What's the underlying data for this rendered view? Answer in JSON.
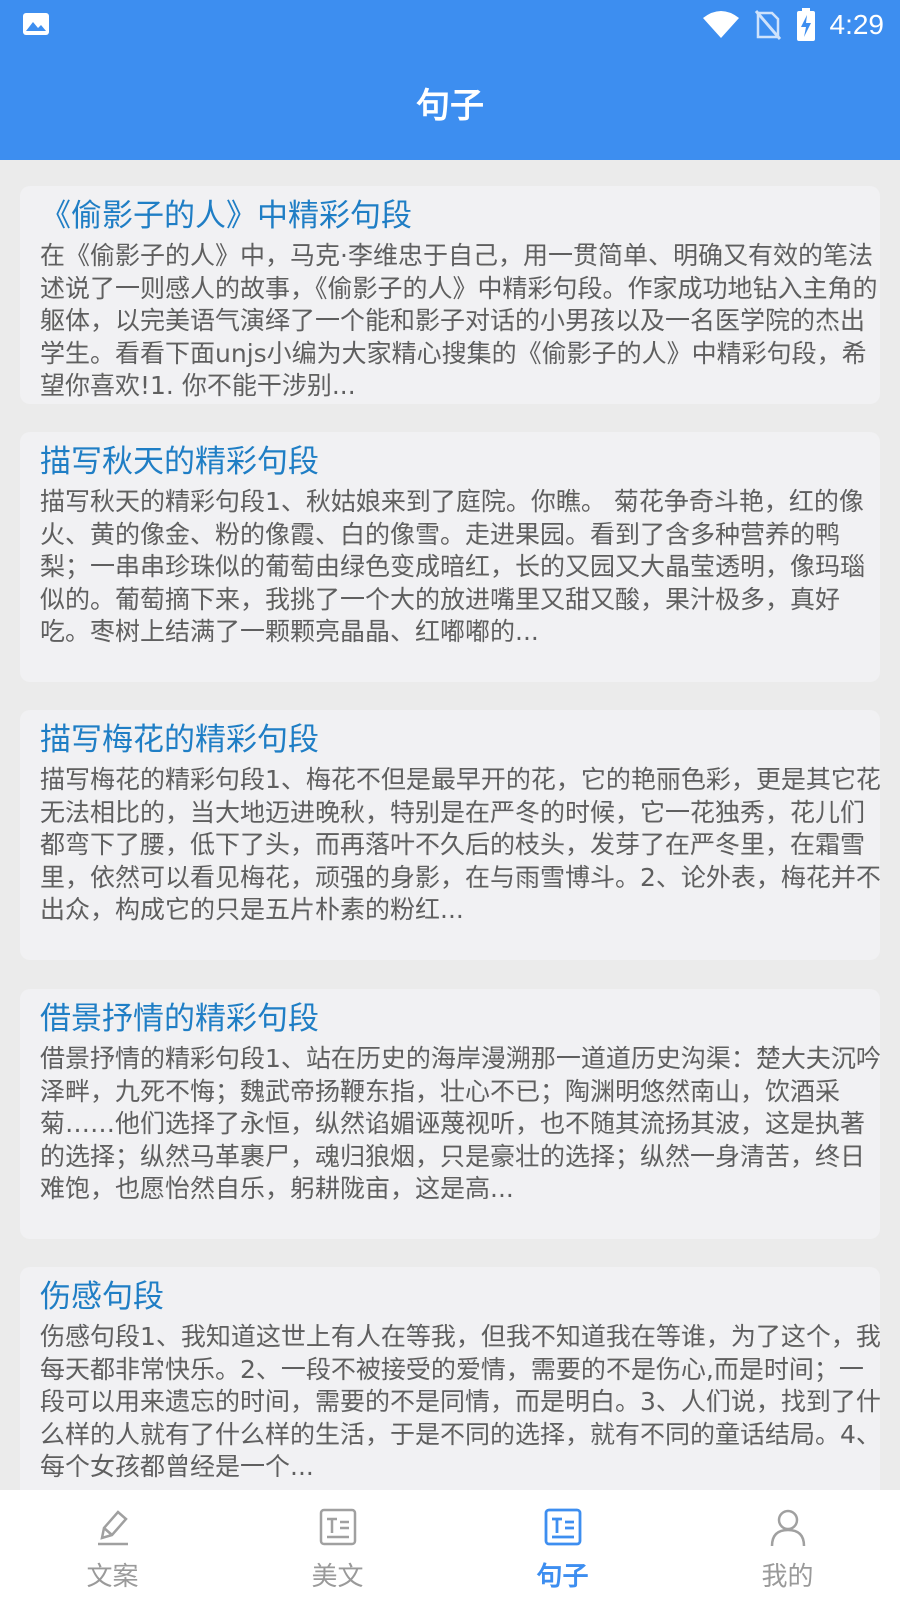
{
  "status_bar": {
    "time": "4:29"
  },
  "header": {
    "title": "句子"
  },
  "articles": [
    {
      "title": "《偷影子的人》中精彩句段",
      "summary": "在《偷影子的人》中，马克·李维忠于自己，用一贯简单、明确又有效的笔法述说了一则感人的故事，《偷影子的人》中精彩句段。作家成功地钻入主角的躯体，以完美语气演绎了一个能和影子对话的小男孩以及一名医学院的杰出学生。看看下面unjs小编为大家精心搜集的《偷影子的人》中精彩句段，希望你喜欢!1. 你不能干涉别..."
    },
    {
      "title": "描写秋天的精彩句段",
      "summary": "描写秋天的精彩句段1、秋姑娘来到了庭院。你瞧。 菊花争奇斗艳，红的像火、黄的像金、粉的像霞、白的像雪。走进果园。看到了含多种营养的鸭梨；一串串珍珠似的葡萄由绿色变成暗红，长的又园又大晶莹透明，像玛瑙似的。葡萄摘下来，我挑了一个大的放进嘴里又甜又酸，果汁极多，真好吃。枣树上结满了一颗颗亮晶晶、红嘟嘟的..."
    },
    {
      "title": "描写梅花的精彩句段",
      "summary": "描写梅花的精彩句段1、梅花不但是最早开的花，它的艳丽色彩，更是其它花无法相比的，当大地迈进晚秋，特别是在严冬的时候，它一花独秀，花儿们都弯下了腰，低下了头，而再落叶不久后的枝头，发芽了在严冬里，在霜雪里，依然可以看见梅花，顽强的身影，在与雨雪博斗。2、论外表，梅花并不出众，构成它的只是五片朴素的粉红..."
    },
    {
      "title": "借景抒情的精彩句段",
      "summary": "借景抒情的精彩句段1、站在历史的海岸漫溯那一道道历史沟渠：楚大夫沉吟泽畔，九死不悔；魏武帝扬鞭东指，壮心不已；陶渊明悠然南山，饮酒采菊……他们选择了永恒，纵然谄媚诬蔑视听，也不随其流扬其波，这是执著的选择；纵然马革裹尸，魂归狼烟，只是豪壮的选择；纵然一身清苦，终日难饱，也愿怡然自乐，躬耕陇亩，这是高..."
    },
    {
      "title": "伤感句段",
      "summary": "伤感句段1、我知道这世上有人在等我，但我不知道我在等谁，为了这个，我每天都非常快乐。2、一段不被接受的爱情，需要的不是伤心,而是时间；一段可以用来遗忘的时间，需要的不是同情，而是明白。3、人们说，找到了什么样的人就有了什么样的生活，于是不同的选择，就有不同的童话结局。4、每个女孩都曾经是一个..."
    }
  ],
  "bottom_nav": [
    {
      "label": "文案",
      "icon": "pen-icon",
      "active": false
    },
    {
      "label": "美文",
      "icon": "text-box-icon",
      "active": false
    },
    {
      "label": "句子",
      "icon": "text-box-icon",
      "active": true
    },
    {
      "label": "我的",
      "icon": "person-icon",
      "active": false
    }
  ],
  "colors": {
    "primary": "#3d8ef0",
    "link": "#1f7ec5",
    "body_text": "#5f5f5f",
    "inactive": "#9a9a9a"
  }
}
